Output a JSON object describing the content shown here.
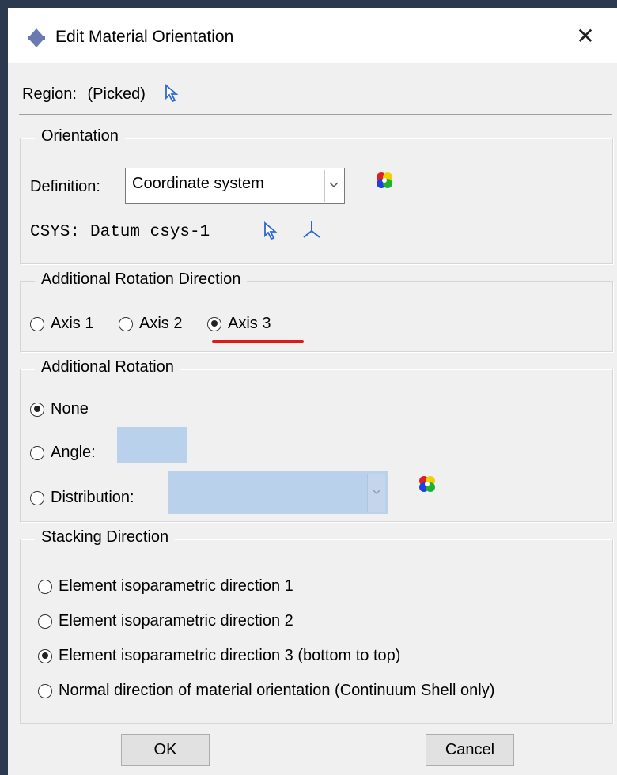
{
  "window": {
    "title": "Edit Material Orientation",
    "close_symbol": "✕"
  },
  "region": {
    "label": "Region:",
    "value": "(Picked)"
  },
  "orientation": {
    "group_title": "Orientation",
    "definition_label": "Definition:",
    "definition_value": "Coordinate system",
    "csys_label": "CSYS:",
    "csys_value": "Datum csys-1"
  },
  "rotation_direction": {
    "group_title": "Additional Rotation Direction",
    "options": [
      "Axis 1",
      "Axis 2",
      "Axis 3"
    ],
    "selected": "Axis 3"
  },
  "additional_rotation": {
    "group_title": "Additional Rotation",
    "none_label": "None",
    "angle_label": "Angle:",
    "angle_value": "",
    "distribution_label": "Distribution:",
    "distribution_value": "",
    "selected": "None"
  },
  "stacking_direction": {
    "group_title": "Stacking Direction",
    "options": [
      "Element isoparametric direction 1",
      "Element isoparametric direction 2",
      "Element isoparametric direction 3 (bottom to top)",
      "Normal direction of material orientation (Continuum Shell only)"
    ],
    "selected_index": 2
  },
  "buttons": {
    "ok": "OK",
    "cancel": "Cancel"
  },
  "colors": {
    "annotation_underline": "#e01818",
    "disabled_field": "#b9d1ea",
    "picker_arrow": "#2a6ad0"
  }
}
